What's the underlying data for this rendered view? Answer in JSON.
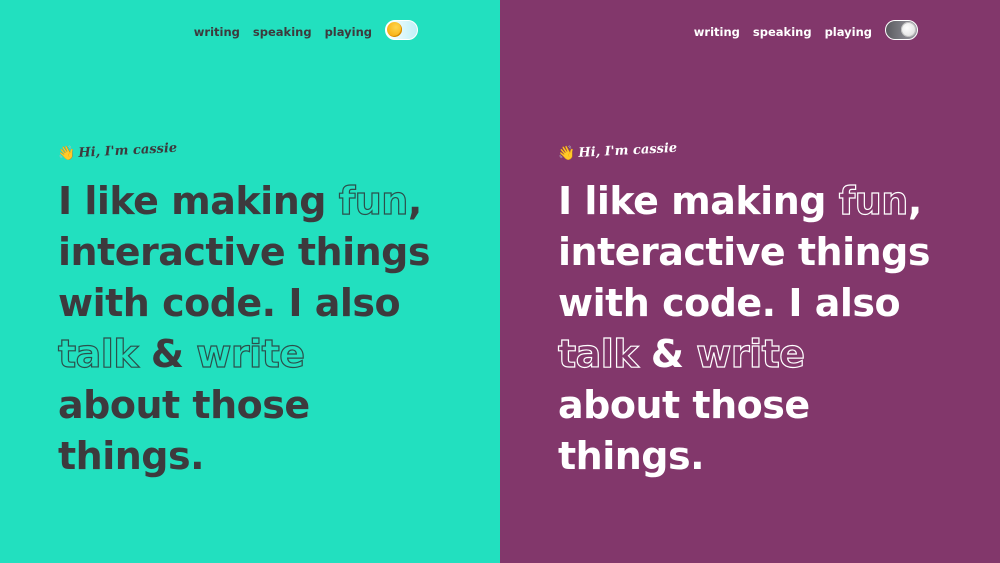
{
  "panels": [
    {
      "theme": "light",
      "background": "#22e0bf",
      "text_color": "#3d3a3d",
      "nav": {
        "links": [
          "writing",
          "speaking",
          "playing"
        ]
      },
      "toggle": {
        "state": "off",
        "knob_icon": "sun-icon"
      },
      "greeting": {
        "icon": "waving-hand",
        "emoji": "👋",
        "text": "Hi, I'm cassie"
      },
      "headline": {
        "line1_a": "I like making ",
        "line1_outline": "fun",
        "line1_b": ",",
        "line2": "interactive things",
        "line3": "with code. I also",
        "line4_outline_a": "talk",
        "line4_mid": " & ",
        "line4_outline_b": "write",
        "line5": "about those",
        "line6": "things."
      }
    },
    {
      "theme": "dark",
      "background": "#82376b",
      "text_color": "#ffffff",
      "nav": {
        "links": [
          "writing",
          "speaking",
          "playing"
        ]
      },
      "toggle": {
        "state": "on",
        "knob_icon": "moon-icon"
      },
      "greeting": {
        "icon": "waving-hand",
        "emoji": "👋",
        "text": "Hi, I'm cassie"
      },
      "headline": {
        "line1_a": "I like making ",
        "line1_outline": "fun",
        "line1_b": ",",
        "line2": "interactive things",
        "line3": "with code. I also",
        "line4_outline_a": "talk",
        "line4_mid": " & ",
        "line4_outline_b": "write",
        "line5": "about those",
        "line6": "things."
      }
    }
  ]
}
